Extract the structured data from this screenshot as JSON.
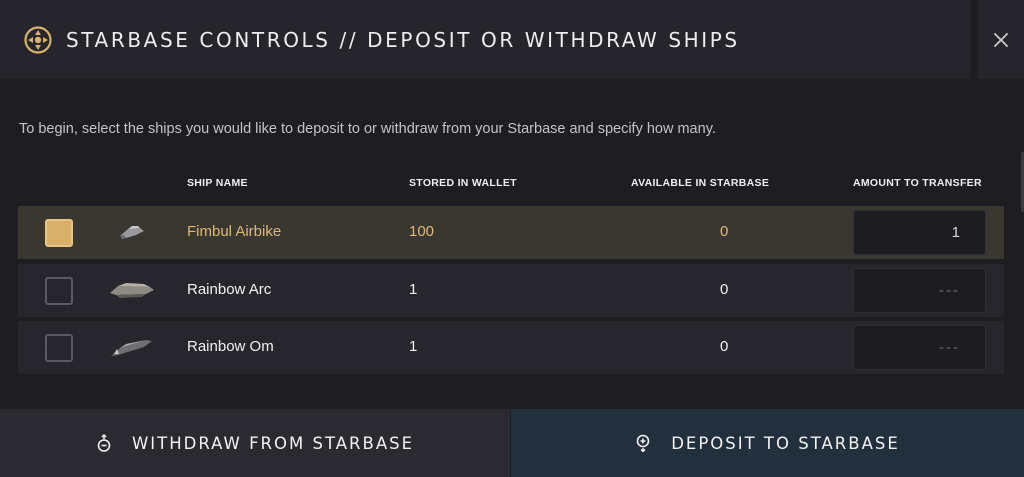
{
  "header": {
    "title": "STARBASE CONTROLS // DEPOSIT OR WITHDRAW SHIPS"
  },
  "intro": "To begin, select the ships you would like to deposit to or withdraw from your Starbase and specify how many.",
  "columns": {
    "ship_name": "SHIP NAME",
    "stored": "STORED IN WALLET",
    "available": "AVAILABLE IN STARBASE",
    "amount": "AMOUNT TO TRANSFER"
  },
  "ships": [
    {
      "name": "Fimbul Airbike",
      "stored": "100",
      "available": "0",
      "amount": "1",
      "placeholder": "---",
      "selected": true
    },
    {
      "name": "Rainbow Arc",
      "stored": "1",
      "available": "0",
      "amount": "",
      "placeholder": "---",
      "selected": false
    },
    {
      "name": "Rainbow Om",
      "stored": "1",
      "available": "0",
      "amount": "",
      "placeholder": "---",
      "selected": false
    }
  ],
  "buttons": {
    "withdraw": "WITHDRAW FROM STARBASE",
    "deposit": "DEPOSIT TO STARBASE"
  },
  "icons": {
    "logo": "starbase-logo-icon",
    "close": "close-icon",
    "withdraw": "withdraw-icon",
    "deposit": "deposit-icon"
  },
  "colors": {
    "accent": "#d8b06a",
    "selected_row": "#3a3731",
    "deposit_button": "#22303d"
  }
}
